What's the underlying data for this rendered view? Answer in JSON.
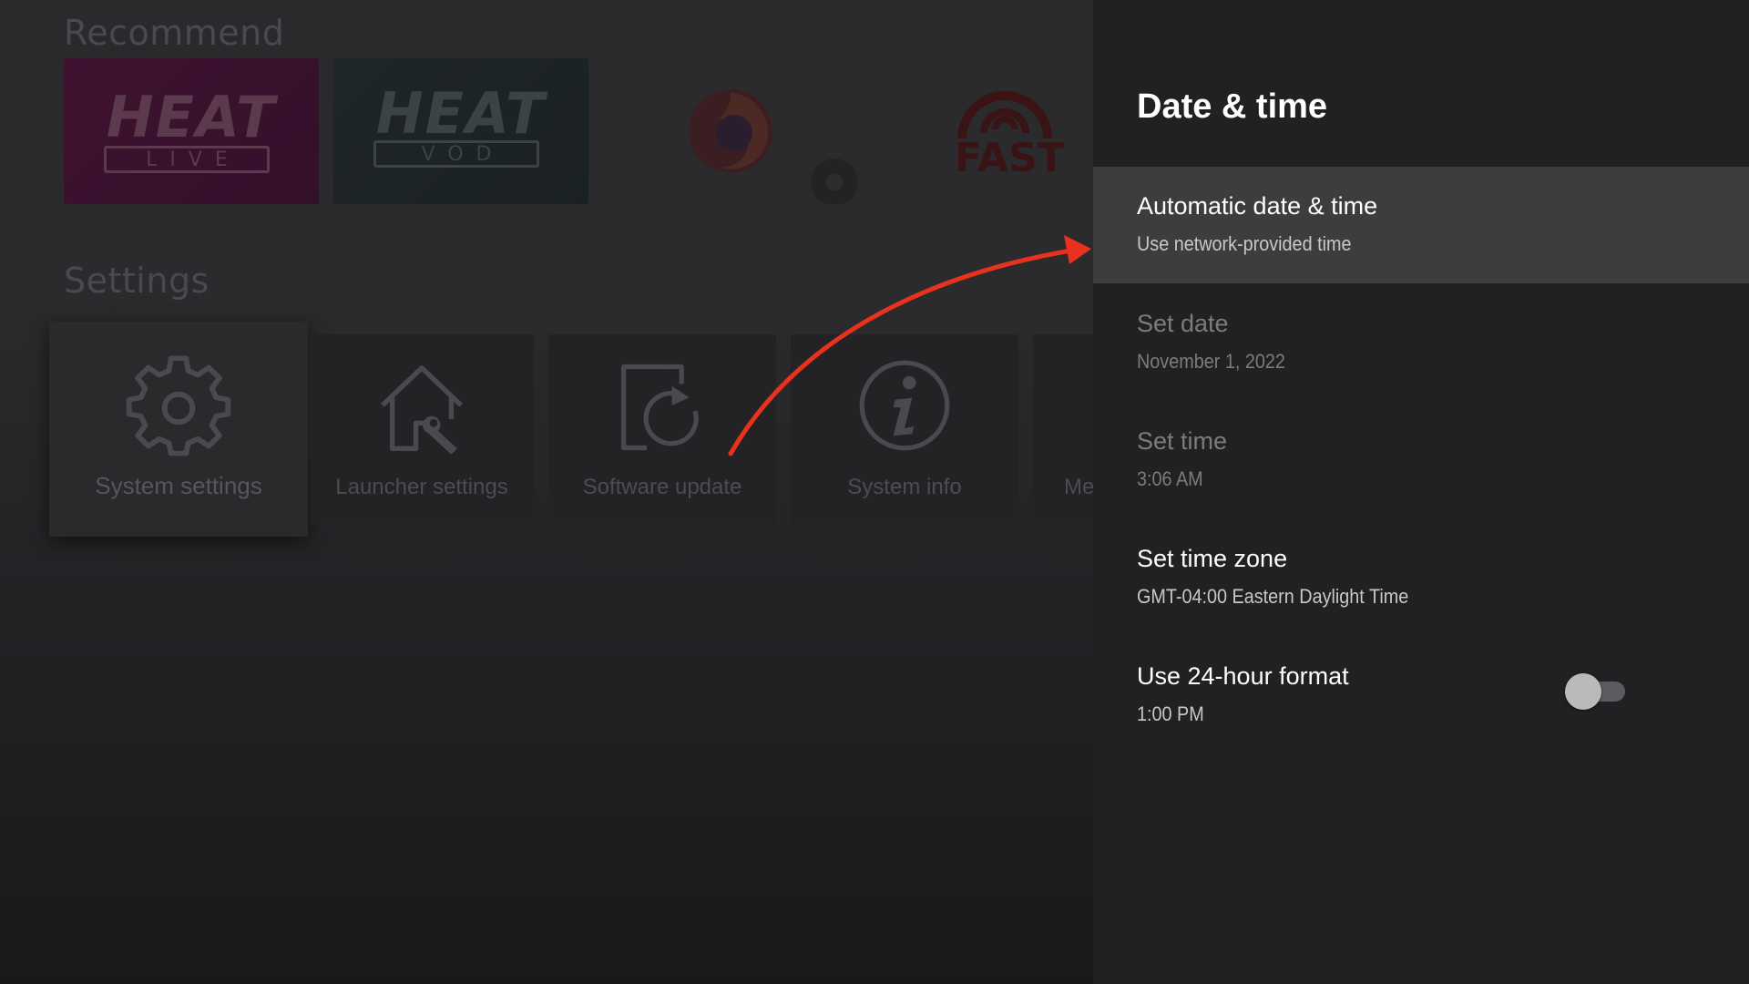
{
  "launcher": {
    "recommend_title": "Recommend",
    "settings_title": "Settings",
    "recommend_tiles": [
      {
        "name": "heat-live",
        "logo": "HEAT",
        "sub": "LIVE",
        "color": "#4a4a4e"
      },
      {
        "name": "heat-vod",
        "logo": "HEAT",
        "sub": "VOD",
        "color": "#4a4a4e"
      },
      {
        "name": "firefox",
        "icon": "firefox-icon"
      },
      {
        "name": "fast",
        "logo": "FAST",
        "icon": "fast-signal-icon"
      }
    ],
    "settings_tiles": [
      {
        "label": "System settings",
        "icon": "gear-icon"
      },
      {
        "label": "Launcher settings",
        "icon": "home-wrench-icon"
      },
      {
        "label": "Software update",
        "icon": "update-icon"
      },
      {
        "label": "System info",
        "icon": "info-icon"
      },
      {
        "label": "Me",
        "icon": ""
      }
    ]
  },
  "panel": {
    "title": "Date & time",
    "items": [
      {
        "primary": "Automatic date & time",
        "secondary": "Use network-provided time",
        "focused": true,
        "disabled": false
      },
      {
        "primary": "Set date",
        "secondary": "November 1, 2022",
        "focused": false,
        "disabled": true
      },
      {
        "primary": "Set time",
        "secondary": "3:06 AM",
        "focused": false,
        "disabled": true
      },
      {
        "primary": "Set time zone",
        "secondary": "GMT-04:00 Eastern Daylight Time",
        "focused": false,
        "disabled": false
      },
      {
        "primary": "Use 24-hour format",
        "secondary": "1:00 PM",
        "focused": false,
        "disabled": false,
        "toggle": false
      }
    ]
  },
  "colors": {
    "panel_bg": "#202123",
    "focused_row": "#3b3d3f",
    "annotation_arrow": "#e8321e"
  }
}
